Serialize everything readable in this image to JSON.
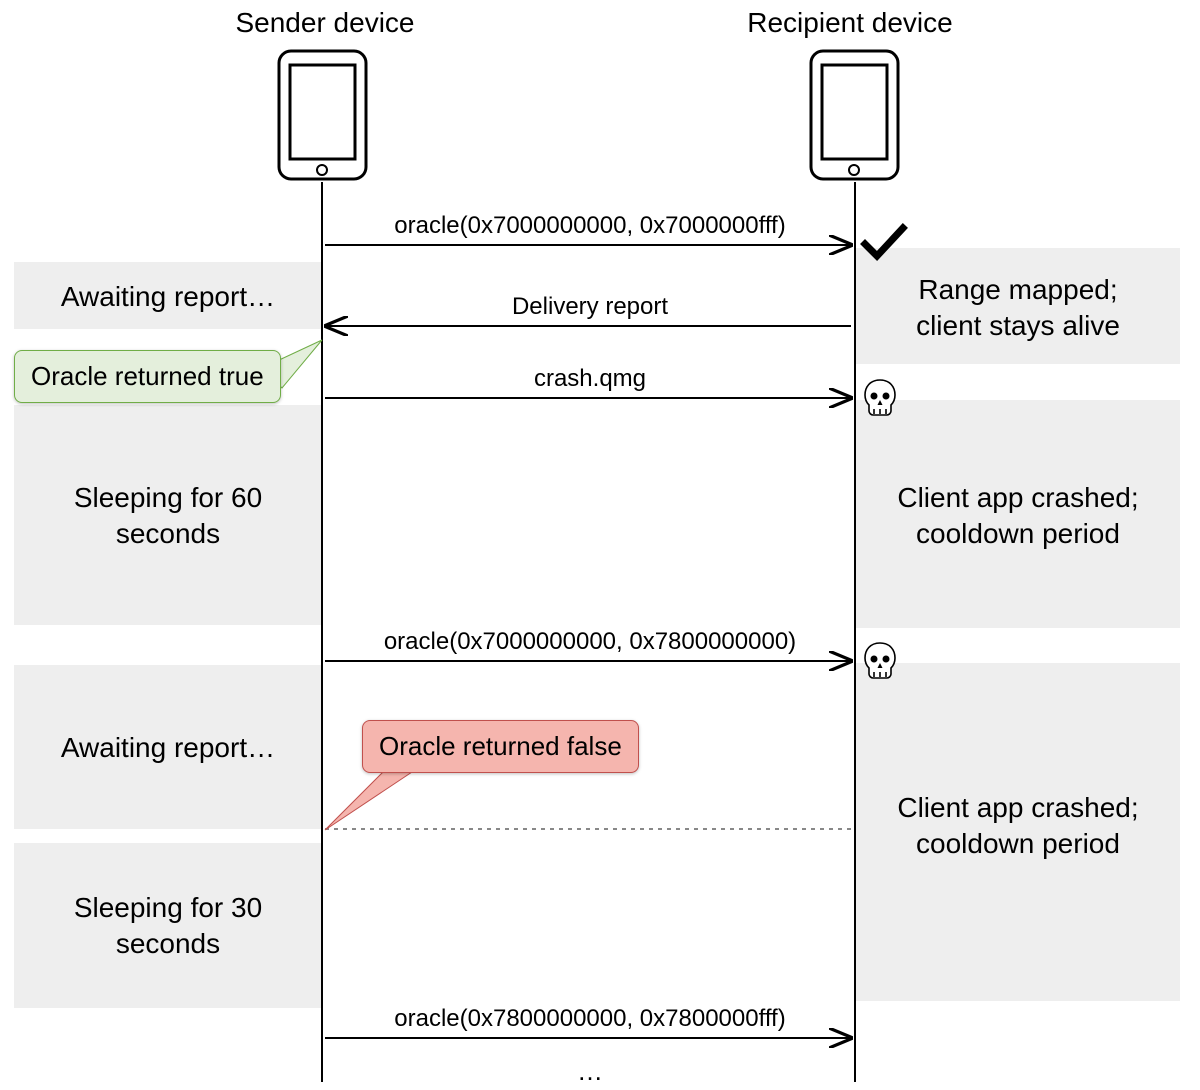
{
  "participants": {
    "sender": "Sender device",
    "recipient": "Recipient device"
  },
  "messages": {
    "oracle1": "oracle(0x7000000000, 0x7000000fff)",
    "deliveryReport": "Delivery report",
    "crashQmg": "crash.qmg",
    "oracle2": "oracle(0x7000000000, 0x7800000000)",
    "oracle3": "oracle(0x7800000000, 0x7800000fff)",
    "continuation": "…"
  },
  "callouts": {
    "oracleTrue": "Oracle returned true",
    "oracleFalse": "Oracle returned false"
  },
  "senderStates": {
    "await1": "Awaiting report…",
    "sleep60": "Sleeping for 60\nseconds",
    "await2": "Awaiting report…",
    "sleep30": "Sleeping for 30\nseconds"
  },
  "recipientStates": {
    "mapped": "Range mapped;\nclient stays alive",
    "crashed1": "Client app crashed;\ncooldown period",
    "crashed2": "Client app crashed;\ncooldown period"
  },
  "icons": {
    "phoneSender": "phone-icon",
    "phoneRecipient": "phone-icon",
    "check": "checkmark-icon",
    "skull1": "skull-icon",
    "skull2": "skull-icon"
  }
}
